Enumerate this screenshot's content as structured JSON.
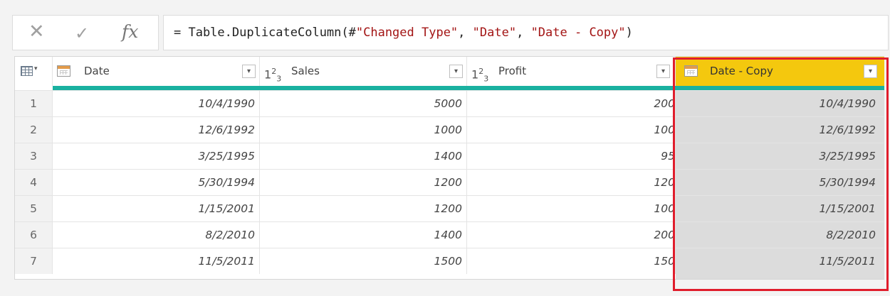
{
  "formula_bar": {
    "icons": [
      "cancel-icon",
      "confirm-icon",
      "fx-icon"
    ],
    "fx_label": "fx",
    "prefix": "= Table.DuplicateColumn(#",
    "arg1": "\"Changed Type\"",
    "sep1": ", ",
    "arg2": "\"Date\"",
    "sep2": ", ",
    "arg3": "\"Date - Copy\"",
    "suffix": ")"
  },
  "columns": [
    {
      "name": "Date",
      "type_icon": "calendar-icon"
    },
    {
      "name": "Sales",
      "type_icon": "whole-number-icon"
    },
    {
      "name": "Profit",
      "type_icon": "whole-number-icon"
    },
    {
      "name": "Date - Copy",
      "type_icon": "calendar-icon",
      "selected": true
    }
  ],
  "rows": [
    {
      "n": "1",
      "date": "10/4/1990",
      "sales": "5000",
      "profit": "200",
      "copy": "10/4/1990"
    },
    {
      "n": "2",
      "date": "12/6/1992",
      "sales": "1000",
      "profit": "100",
      "copy": "12/6/1992"
    },
    {
      "n": "3",
      "date": "3/25/1995",
      "sales": "1400",
      "profit": "95",
      "copy": "3/25/1995"
    },
    {
      "n": "4",
      "date": "5/30/1994",
      "sales": "1200",
      "profit": "120",
      "copy": "5/30/1994"
    },
    {
      "n": "5",
      "date": "1/15/2001",
      "sales": "1200",
      "profit": "100",
      "copy": "1/15/2001"
    },
    {
      "n": "6",
      "date": "8/2/2010",
      "sales": "1400",
      "profit": "200",
      "copy": "8/2/2010"
    },
    {
      "n": "7",
      "date": "11/5/2011",
      "sales": "1500",
      "profit": "150",
      "copy": "11/5/2011"
    }
  ],
  "colors": {
    "quality_bar": "#1ab1a0",
    "selected_header": "#f4c80e",
    "selected_column": "#dcdcdc",
    "highlight_border": "#e01d2c",
    "string_literal": "#a31515"
  }
}
